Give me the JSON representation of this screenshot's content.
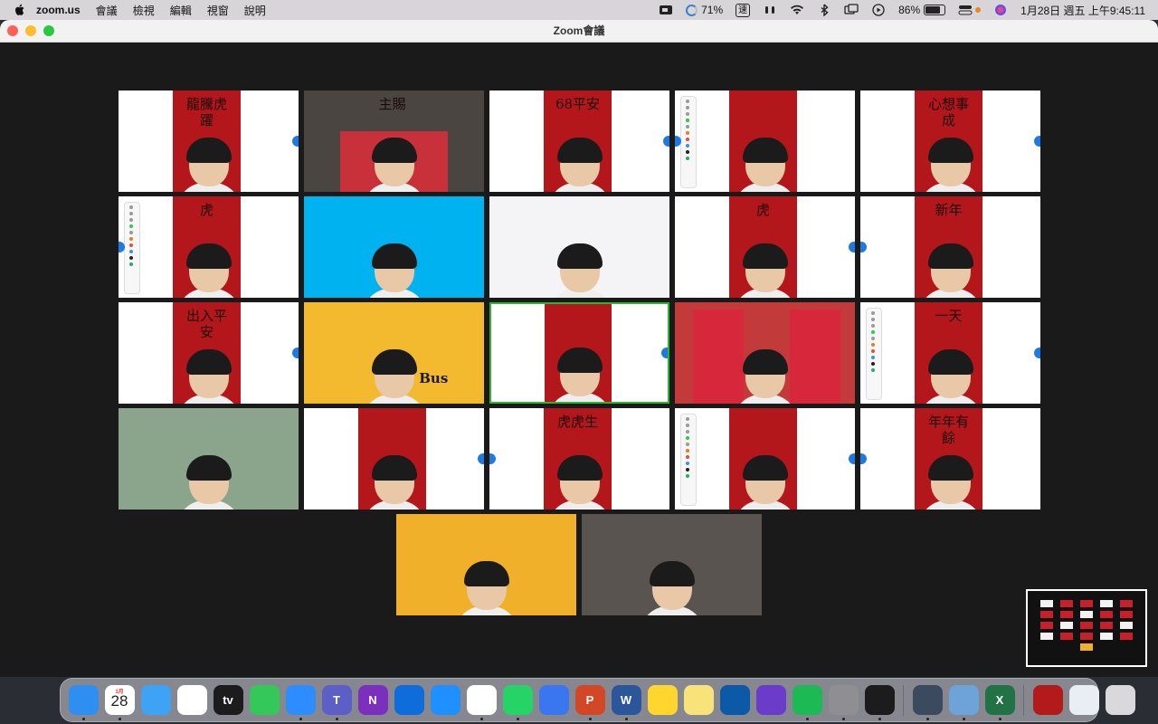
{
  "menubar": {
    "app_name": "zoom.us",
    "menus": [
      "會議",
      "檢視",
      "編輯",
      "視窗",
      "說明"
    ],
    "cpu_percent": "71%",
    "input_method": "速",
    "battery_percent": "86%",
    "battery_level": 0.86,
    "datetime": "1月28日 週五 上午9:45:11"
  },
  "window": {
    "title": "Zoom會議"
  },
  "video_tiles": [
    {
      "id": "tile-1",
      "banner_text": "龍騰虎躍",
      "style": "banner"
    },
    {
      "id": "tile-2",
      "banner_text": "主賜",
      "style": "dark"
    },
    {
      "id": "tile-3",
      "banner_text": "68平安",
      "style": "banner"
    },
    {
      "id": "tile-4",
      "banner_text": "",
      "style": "whiteboard"
    },
    {
      "id": "tile-5",
      "banner_text": "心想事成",
      "style": "banner"
    },
    {
      "id": "tile-6",
      "banner_text": "虎",
      "style": "whiteboard"
    },
    {
      "id": "tile-7",
      "banner_text": "",
      "style": "blue"
    },
    {
      "id": "tile-8",
      "banner_text": "",
      "style": "white"
    },
    {
      "id": "tile-9",
      "banner_text": "虎",
      "style": "banner"
    },
    {
      "id": "tile-10",
      "banner_text": "新年",
      "style": "banner"
    },
    {
      "id": "tile-11",
      "banner_text": "出入平安",
      "style": "banner"
    },
    {
      "id": "tile-12",
      "banner_text": "Bus",
      "style": "yellow"
    },
    {
      "id": "tile-13",
      "banner_text": "",
      "style": "active"
    },
    {
      "id": "tile-14",
      "banner_text": "",
      "style": "teacher"
    },
    {
      "id": "tile-15",
      "banner_text": "一天",
      "style": "whiteboard"
    },
    {
      "id": "tile-16",
      "banner_text": "",
      "style": "green"
    },
    {
      "id": "tile-17",
      "banner_text": "",
      "style": "banner"
    },
    {
      "id": "tile-18",
      "banner_text": "虎虎生",
      "style": "banner"
    },
    {
      "id": "tile-19",
      "banner_text": "",
      "style": "whiteboard"
    },
    {
      "id": "tile-20",
      "banner_text": "年年有餘",
      "style": "banner"
    },
    {
      "id": "tile-21",
      "banner_text": "",
      "style": "orange"
    },
    {
      "id": "tile-22",
      "banner_text": "",
      "style": "room"
    }
  ],
  "dock": {
    "apps": [
      {
        "name": "finder",
        "color": "#2f8ff0"
      },
      {
        "name": "calendar",
        "color": "#ffffff",
        "month": "1月",
        "day": "28"
      },
      {
        "name": "mail",
        "color": "#3ea2f5"
      },
      {
        "name": "photos",
        "color": "#ffffff"
      },
      {
        "name": "apple-tv",
        "color": "#1c1c1e",
        "label": "tv"
      },
      {
        "name": "facetime",
        "color": "#34c759"
      },
      {
        "name": "zoom",
        "color": "#2d8cff"
      },
      {
        "name": "teams",
        "color": "#5b5fc7",
        "label": "T"
      },
      {
        "name": "onenote",
        "color": "#7b2fbd",
        "label": "N"
      },
      {
        "name": "onedrive",
        "color": "#0f6cdb"
      },
      {
        "name": "safari",
        "color": "#1e90ff"
      },
      {
        "name": "chrome",
        "color": "#ffffff"
      },
      {
        "name": "whatsapp",
        "color": "#25d366"
      },
      {
        "name": "signal",
        "color": "#3a76f0"
      },
      {
        "name": "powerpoint",
        "color": "#d24726",
        "label": "P"
      },
      {
        "name": "word",
        "color": "#2b579a",
        "label": "W"
      },
      {
        "name": "notes",
        "color": "#ffd52e"
      },
      {
        "name": "stickies",
        "color": "#f8e27a"
      },
      {
        "name": "flutter-lite",
        "color": "#0c59a8"
      },
      {
        "name": "imovie",
        "color": "#6a3cc9"
      },
      {
        "name": "spotify",
        "color": "#1db954"
      },
      {
        "name": "system-preferences",
        "color": "#8e8e93"
      },
      {
        "name": "activity-monitor",
        "color": "#1c1c1e"
      },
      {
        "name": "quicktime",
        "color": "#3b4a5e"
      },
      {
        "name": "preview",
        "color": "#6ea3d9"
      },
      {
        "name": "excel",
        "color": "#217346",
        "label": "X"
      },
      {
        "name": "screenshot-folder",
        "color": "#b31b1b"
      },
      {
        "name": "zoom-window",
        "color": "#e9eef4"
      },
      {
        "name": "trash",
        "color": "#d9d9dd"
      }
    ]
  }
}
